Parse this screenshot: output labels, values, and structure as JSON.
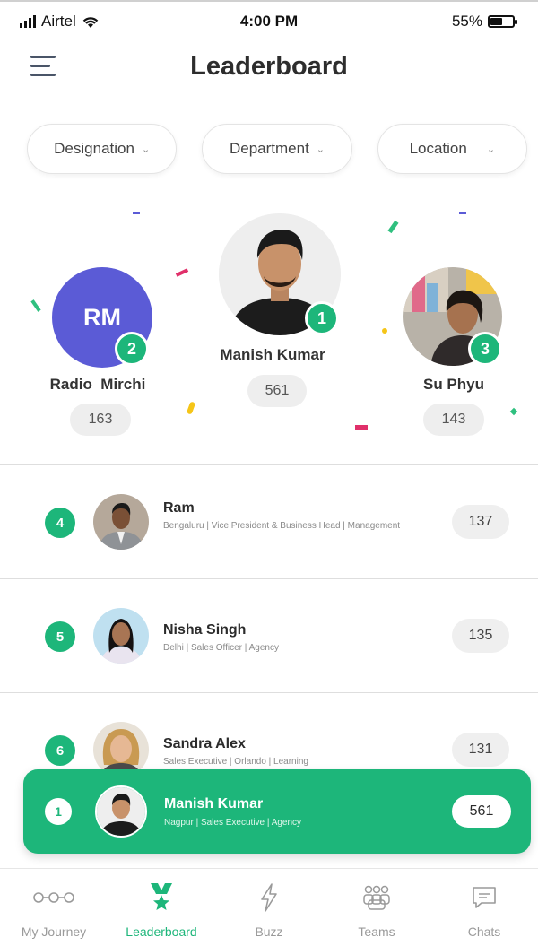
{
  "status_bar": {
    "carrier": "Airtel",
    "time": "4:00 PM",
    "battery": "55%",
    "battery_level": 0.55
  },
  "header": {
    "title": "Leaderboard",
    "menu_icon": "hamburger-icon"
  },
  "filters": [
    {
      "label": "Designation",
      "icon": "chevron-down-icon"
    },
    {
      "label": "Department",
      "icon": "chevron-down-icon"
    },
    {
      "label": "Location",
      "icon": "chevron-down-icon"
    }
  ],
  "podium": {
    "first": {
      "rank": "1",
      "name": "Manish Kumar",
      "score": "561"
    },
    "second": {
      "rank": "2",
      "name": "Radio  Mirchi",
      "initials": "RM",
      "score": "163"
    },
    "third": {
      "rank": "3",
      "name": "Su Phyu",
      "score": "143"
    }
  },
  "list": [
    {
      "rank": "4",
      "name": "Ram",
      "meta": "Bengaluru | Vice President & Business Head | Management",
      "score": "137"
    },
    {
      "rank": "5",
      "name": "Nisha Singh",
      "meta": "Delhi | Sales Officer | Agency",
      "score": "135"
    },
    {
      "rank": "6",
      "name": "Sandra Alex",
      "meta": "Sales Executive | Orlando | Learning",
      "score": "131"
    }
  ],
  "current_user": {
    "rank": "1",
    "name": "Manish Kumar",
    "meta": "Nagpur | Sales Executive | Agency",
    "score": "561"
  },
  "bottom_nav": [
    {
      "label": "My Journey",
      "icon": "journey-icon"
    },
    {
      "label": "Leaderboard",
      "icon": "trophy-icon",
      "active": true
    },
    {
      "label": "Buzz",
      "icon": "lightning-icon"
    },
    {
      "label": "Teams",
      "icon": "team-icon"
    },
    {
      "label": "Chats",
      "icon": "chat-icon"
    }
  ],
  "colors": {
    "accent": "#1db67a",
    "avatar_rm": "#5b5bd6"
  }
}
